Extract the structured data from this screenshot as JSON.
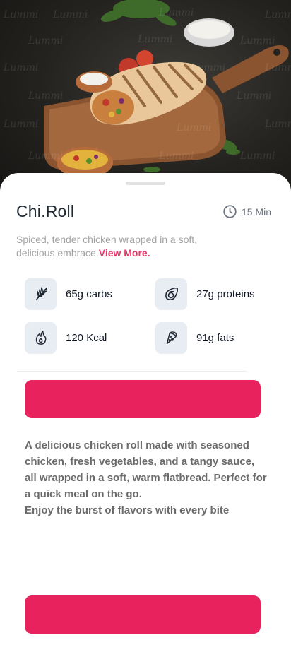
{
  "recipe": {
    "title": "Chi.Roll",
    "time": "15 Min",
    "summary": "Spiced, tender chicken wrapped in a soft, delicious embrace.",
    "view_more_label": "View More.",
    "nutrition": [
      {
        "label": "65g carbs",
        "icon": "wheat-icon"
      },
      {
        "label": "27g proteins",
        "icon": "avocado-icon"
      },
      {
        "label": "120 Kcal",
        "icon": "flame-icon"
      },
      {
        "label": "91g fats",
        "icon": "pizza-slice-icon"
      }
    ],
    "description_line1": "A delicious chicken roll made with seasoned chicken, fresh vegetables, and a tangy sauce, all wrapped in a soft, warm flatbread. Perfect for a quick meal on the go.",
    "description_line2": "Enjoy the burst of flavors with every bite"
  },
  "hero": {
    "watermark_text": "Lummi"
  },
  "actions": {
    "primary_button_label": "",
    "secondary_button_label": ""
  },
  "colors": {
    "accent": "#e8225c",
    "link": "#e8376b",
    "icon_bg": "#e8ecf3"
  }
}
